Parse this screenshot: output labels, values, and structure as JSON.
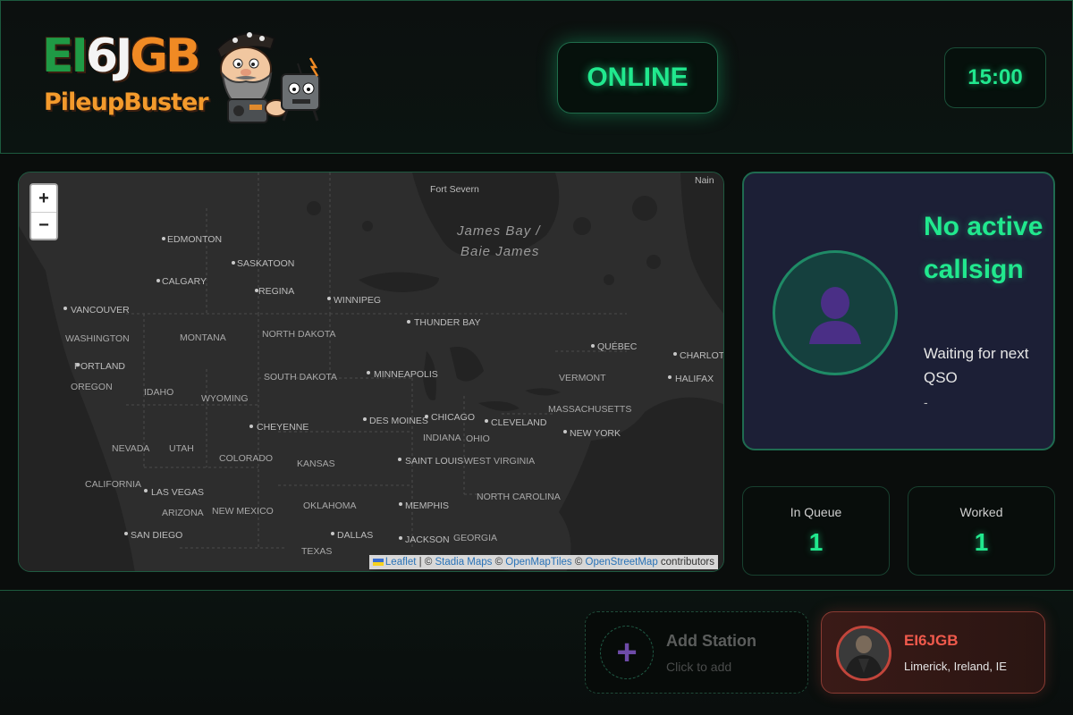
{
  "header": {
    "logo": {
      "title_part1": "EI",
      "title_part2": "6J",
      "title_part3": "GB",
      "subtitle": "PileupBuster"
    },
    "status": "ONLINE",
    "timer": "15:00"
  },
  "map": {
    "zoom_in": "+",
    "zoom_out": "−",
    "water_labels": [
      "James Bay /",
      "Baie James"
    ],
    "cities": [
      "Fort Severn",
      "Nain",
      "EDMONTON",
      "SASKATOON",
      "CALGARY",
      "REGINA",
      "WINNIPEG",
      "VANCOUVER",
      "THUNDER BAY",
      "QUÉBEC",
      "CHARLOTT",
      "HALIFAX",
      "MINNEAPOLIS",
      "PORTLAND",
      "CHEYENNE",
      "DES MOINES",
      "CHICAGO",
      "CLEVELAND",
      "NEW YORK",
      "SAINT LOUIS",
      "LAS VEGAS",
      "SAN DIEGO",
      "MEMPHIS",
      "DALLAS",
      "JACKSON"
    ],
    "states": [
      "WASHINGTON",
      "MONTANA",
      "NORTH DAKOTA",
      "OREGON",
      "IDAHO",
      "SOUTH DAKOTA",
      "WYOMING",
      "VERMONT",
      "MASSACHUSETTS",
      "NEVADA",
      "UTAH",
      "COLORADO",
      "KANSAS",
      "INDIANA",
      "OHIO",
      "WEST VIRGINIA",
      "CALIFORNIA",
      "ARIZONA",
      "NEW MEXICO",
      "OKLAHOMA",
      "NORTH CAROLINA",
      "TEXAS",
      "GEORGIA"
    ],
    "attribution": {
      "leaflet": "Leaflet",
      "sep1": " | © ",
      "stadia": "Stadia Maps",
      "sep2": " © ",
      "omt": "OpenMapTiles",
      "sep3": " © ",
      "osm": "OpenStreetMap",
      "suffix": " contributors"
    }
  },
  "active": {
    "title": "No active callsign",
    "subtitle": "Waiting for next QSO",
    "detail": "-"
  },
  "stats": {
    "queue_label": "In Queue",
    "queue_value": "1",
    "worked_label": "Worked",
    "worked_value": "1"
  },
  "footer": {
    "add_icon": "+",
    "add_title": "Add Station",
    "add_sub": "Click to add",
    "station_call": "EI6JGB",
    "station_location": "Limerick, Ireland, IE"
  },
  "colors": {
    "accent": "#21e88e",
    "card_bg": "#1c1f36",
    "station_accent": "#f05a4c"
  }
}
